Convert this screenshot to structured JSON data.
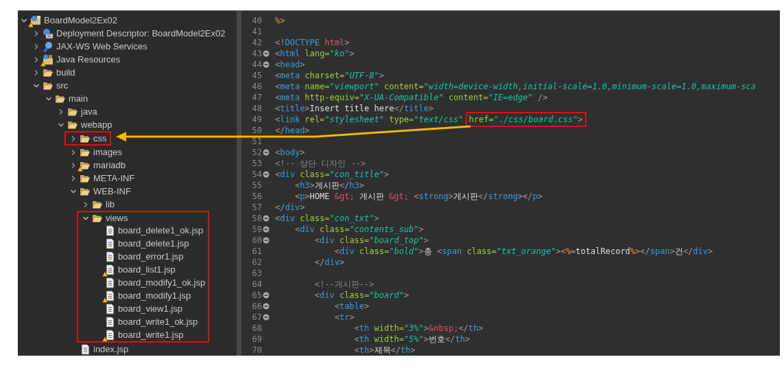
{
  "project_explorer": {
    "tree": [
      {
        "label": "BoardModel2Ex02",
        "kind": "project",
        "warning": true,
        "expanded": true,
        "highlighted": false,
        "children": [
          {
            "label": "Deployment Descriptor: BoardModel2Ex02",
            "kind": "descriptor",
            "warning": false,
            "expanded": false,
            "highlighted": false
          },
          {
            "label": "JAX-WS Web Services",
            "kind": "services",
            "warning": false,
            "expanded": false,
            "highlighted": false
          },
          {
            "label": "Java Resources",
            "kind": "resources",
            "warning": true,
            "expanded": false,
            "highlighted": false
          },
          {
            "label": "build",
            "kind": "folder",
            "warning": false,
            "expanded": false,
            "highlighted": false
          },
          {
            "label": "src",
            "kind": "folder",
            "warning": false,
            "expanded": true,
            "highlighted": false,
            "children": [
              {
                "label": "main",
                "kind": "folder",
                "warning": false,
                "expanded": true,
                "highlighted": false,
                "children": [
                  {
                    "label": "java",
                    "kind": "folder",
                    "warning": false,
                    "expanded": false,
                    "highlighted": false
                  },
                  {
                    "label": "webapp",
                    "kind": "folder",
                    "warning": false,
                    "expanded": true,
                    "highlighted": false,
                    "children": [
                      {
                        "label": "css",
                        "kind": "folder",
                        "warning": false,
                        "expanded": false,
                        "highlighted": true
                      },
                      {
                        "label": "images",
                        "kind": "folder",
                        "warning": false,
                        "expanded": false,
                        "highlighted": false
                      },
                      {
                        "label": "mariadb",
                        "kind": "folder",
                        "warning": true,
                        "expanded": false,
                        "highlighted": false
                      },
                      {
                        "label": "META-INF",
                        "kind": "folder",
                        "warning": false,
                        "expanded": false,
                        "highlighted": false
                      },
                      {
                        "label": "WEB-INF",
                        "kind": "folder",
                        "warning": false,
                        "expanded": true,
                        "highlighted": false,
                        "children": [
                          {
                            "label": "lib",
                            "kind": "folder",
                            "warning": false,
                            "expanded": false,
                            "highlighted": false
                          },
                          {
                            "label": "views",
                            "kind": "folder",
                            "warning": false,
                            "expanded": true,
                            "highlighted": true,
                            "children": [
                              {
                                "label": "board_delete1_ok.jsp",
                                "kind": "file",
                                "warning": false,
                                "highlighted": false
                              },
                              {
                                "label": "board_delete1.jsp",
                                "kind": "file",
                                "warning": false,
                                "highlighted": false
                              },
                              {
                                "label": "board_error1.jsp",
                                "kind": "file",
                                "warning": false,
                                "highlighted": false
                              },
                              {
                                "label": "board_list1.jsp",
                                "kind": "file",
                                "warning": true,
                                "highlighted": false
                              },
                              {
                                "label": "board_modify1_ok.jsp",
                                "kind": "file",
                                "warning": false,
                                "highlighted": false
                              },
                              {
                                "label": "board_modify1.jsp",
                                "kind": "file",
                                "warning": true,
                                "highlighted": false
                              },
                              {
                                "label": "board_view1.jsp",
                                "kind": "file",
                                "warning": false,
                                "highlighted": false
                              },
                              {
                                "label": "board_write1_ok.jsp",
                                "kind": "file",
                                "warning": false,
                                "highlighted": false
                              },
                              {
                                "label": "board_write1.jsp",
                                "kind": "file",
                                "warning": true,
                                "highlighted": false
                              }
                            ]
                          }
                        ]
                      },
                      {
                        "label": "index.jsp",
                        "kind": "file",
                        "warning": false,
                        "highlighted": false
                      }
                    ]
                  }
                ]
              }
            ]
          }
        ]
      }
    ]
  },
  "editor": {
    "lines": [
      {
        "number": "40",
        "fold": false,
        "tokens": [
          {
            "kind": "jsp",
            "text": "%>"
          }
        ]
      },
      {
        "number": "41",
        "fold": false
      },
      {
        "number": "42",
        "fold": false,
        "tokens": [
          {
            "kind": "punct",
            "text": "<!"
          },
          {
            "kind": "tag",
            "text": "DOCTYPE "
          },
          {
            "kind": "entity",
            "text": "html"
          },
          {
            "kind": "punct",
            "text": ">"
          }
        ]
      },
      {
        "number": "43",
        "fold": true,
        "tokens": [
          {
            "kind": "punct",
            "text": "<"
          },
          {
            "kind": "tag",
            "text": "html "
          },
          {
            "kind": "attr",
            "text": "lang="
          },
          {
            "kind": "value",
            "text": "\"ko\""
          },
          {
            "kind": "punct",
            "text": ">"
          }
        ]
      },
      {
        "number": "44",
        "fold": true,
        "tokens": [
          {
            "kind": "punct",
            "text": "<"
          },
          {
            "kind": "tag",
            "text": "head"
          },
          {
            "kind": "punct",
            "text": ">"
          }
        ]
      },
      {
        "number": "45",
        "fold": false,
        "tokens": [
          {
            "kind": "punct",
            "text": "<"
          },
          {
            "kind": "tag",
            "text": "meta "
          },
          {
            "kind": "attr",
            "text": "charset="
          },
          {
            "kind": "value",
            "text": "\"UTF-8\""
          },
          {
            "kind": "punct",
            "text": ">"
          }
        ]
      },
      {
        "number": "46",
        "fold": false,
        "tokens": [
          {
            "kind": "punct",
            "text": "<"
          },
          {
            "kind": "tag",
            "text": "meta "
          },
          {
            "kind": "attr",
            "text": "name="
          },
          {
            "kind": "value",
            "text": "\"viewport\" "
          },
          {
            "kind": "attr",
            "text": "content="
          },
          {
            "kind": "value",
            "text": "\"width=device-width,initial-scale=1.0,minimum-scale=1.0,maximum-sca"
          }
        ]
      },
      {
        "number": "47",
        "fold": false,
        "tokens": [
          {
            "kind": "punct",
            "text": "<"
          },
          {
            "kind": "tag",
            "text": "meta "
          },
          {
            "kind": "attr",
            "text": "http-equiv="
          },
          {
            "kind": "value",
            "text": "\"X-UA-Compatible\" "
          },
          {
            "kind": "attr",
            "text": "content="
          },
          {
            "kind": "value",
            "text": "\"IE=edge\" "
          },
          {
            "kind": "punct",
            "text": "/>"
          }
        ]
      },
      {
        "number": "48",
        "fold": false,
        "tokens": [
          {
            "kind": "punct",
            "text": "<"
          },
          {
            "kind": "tag",
            "text": "title"
          },
          {
            "kind": "punct",
            "text": ">"
          },
          {
            "kind": "text",
            "text": "Insert title here"
          },
          {
            "kind": "punct",
            "text": "</"
          },
          {
            "kind": "tag",
            "text": "title"
          },
          {
            "kind": "punct",
            "text": ">"
          }
        ]
      },
      {
        "number": "49",
        "fold": false,
        "tokens": [
          {
            "kind": "punct",
            "text": "<"
          },
          {
            "kind": "tag",
            "text": "link "
          },
          {
            "kind": "attr",
            "text": "rel="
          },
          {
            "kind": "value",
            "text": "\"stylesheet\" "
          },
          {
            "kind": "attr",
            "text": "type="
          },
          {
            "kind": "value",
            "text": "\"text/css\""
          }
        ],
        "boxed": [
          {
            "kind": "attr",
            "text": "href="
          },
          {
            "kind": "value",
            "text": "\"./css/board.css\""
          },
          {
            "kind": "punct",
            "text": ">"
          }
        ]
      },
      {
        "number": "50",
        "fold": false,
        "tokens": [
          {
            "kind": "punct",
            "text": "</"
          },
          {
            "kind": "tag",
            "text": "head"
          },
          {
            "kind": "punct",
            "text": ">"
          }
        ]
      },
      {
        "number": "51",
        "fold": false
      },
      {
        "number": "52",
        "fold": true,
        "tokens": [
          {
            "kind": "punct",
            "text": "<"
          },
          {
            "kind": "tag",
            "text": "body"
          },
          {
            "kind": "punct",
            "text": ">"
          }
        ]
      },
      {
        "number": "53",
        "fold": false,
        "tokens": [
          {
            "kind": "comment",
            "text": "<!-- 상단 디자인 -->"
          }
        ]
      },
      {
        "number": "54",
        "fold": true,
        "tokens": [
          {
            "kind": "punct",
            "text": "<"
          },
          {
            "kind": "tag",
            "text": "div "
          },
          {
            "kind": "attr",
            "text": "class="
          },
          {
            "kind": "value",
            "text": "\"con_title\""
          },
          {
            "kind": "punct",
            "text": ">"
          }
        ]
      },
      {
        "number": "55",
        "fold": false,
        "tokens": [
          {
            "kind": "punct",
            "text": "    <"
          },
          {
            "kind": "tag",
            "text": "h3"
          },
          {
            "kind": "punct",
            "text": ">"
          },
          {
            "kind": "text",
            "text": "게시판"
          },
          {
            "kind": "punct",
            "text": "</"
          },
          {
            "kind": "tag",
            "text": "h3"
          },
          {
            "kind": "punct",
            "text": ">"
          }
        ]
      },
      {
        "number": "56",
        "fold": false,
        "tokens": [
          {
            "kind": "punct",
            "text": "    <"
          },
          {
            "kind": "tag",
            "text": "p"
          },
          {
            "kind": "punct",
            "text": ">"
          },
          {
            "kind": "text",
            "text": "HOME "
          },
          {
            "kind": "entity",
            "text": "&gt;"
          },
          {
            "kind": "text",
            "text": " 게시판 "
          },
          {
            "kind": "entity",
            "text": "&gt;"
          },
          {
            "kind": "punct",
            "text": " <"
          },
          {
            "kind": "tag",
            "text": "strong"
          },
          {
            "kind": "punct",
            "text": ">"
          },
          {
            "kind": "text",
            "text": "게시판"
          },
          {
            "kind": "punct",
            "text": "</"
          },
          {
            "kind": "tag",
            "text": "strong"
          },
          {
            "kind": "punct",
            "text": "></"
          },
          {
            "kind": "tag",
            "text": "p"
          },
          {
            "kind": "punct",
            "text": ">"
          }
        ]
      },
      {
        "number": "57",
        "fold": false,
        "tokens": [
          {
            "kind": "punct",
            "text": "</"
          },
          {
            "kind": "tag",
            "text": "div"
          },
          {
            "kind": "punct",
            "text": ">"
          }
        ]
      },
      {
        "number": "58",
        "fold": true,
        "tokens": [
          {
            "kind": "punct",
            "text": "<"
          },
          {
            "kind": "tag",
            "text": "div "
          },
          {
            "kind": "attr",
            "text": "class="
          },
          {
            "kind": "value",
            "text": "\"con_txt\""
          },
          {
            "kind": "punct",
            "text": ">"
          }
        ]
      },
      {
        "number": "59",
        "fold": true,
        "tokens": [
          {
            "kind": "punct",
            "text": "    <"
          },
          {
            "kind": "tag",
            "text": "div "
          },
          {
            "kind": "attr",
            "text": "class="
          },
          {
            "kind": "value",
            "text": "\"contents_sub\""
          },
          {
            "kind": "punct",
            "text": ">"
          }
        ]
      },
      {
        "number": "60",
        "fold": true,
        "tokens": [
          {
            "kind": "punct",
            "text": "        <"
          },
          {
            "kind": "tag",
            "text": "div "
          },
          {
            "kind": "attr",
            "text": "class="
          },
          {
            "kind": "value",
            "text": "\"board_top\""
          },
          {
            "kind": "punct",
            "text": ">"
          }
        ]
      },
      {
        "number": "61",
        "fold": false,
        "tokens": [
          {
            "kind": "punct",
            "text": "            <"
          },
          {
            "kind": "tag",
            "text": "div "
          },
          {
            "kind": "attr",
            "text": "class="
          },
          {
            "kind": "value",
            "text": "\"bold\""
          },
          {
            "kind": "punct",
            "text": ">"
          },
          {
            "kind": "text",
            "text": "총 "
          },
          {
            "kind": "punct",
            "text": "<"
          },
          {
            "kind": "tag",
            "text": "span "
          },
          {
            "kind": "attr",
            "text": "class="
          },
          {
            "kind": "value",
            "text": "\"txt_orange\""
          },
          {
            "kind": "punct",
            "text": ">"
          },
          {
            "kind": "jsp",
            "text": "<%="
          },
          {
            "kind": "text",
            "text": "totalRecord"
          },
          {
            "kind": "jsp",
            "text": "%>"
          },
          {
            "kind": "punct",
            "text": "</"
          },
          {
            "kind": "tag",
            "text": "span"
          },
          {
            "kind": "punct",
            "text": ">"
          },
          {
            "kind": "text",
            "text": "건"
          },
          {
            "kind": "punct",
            "text": "</"
          },
          {
            "kind": "tag",
            "text": "div"
          },
          {
            "kind": "punct",
            "text": ">"
          }
        ]
      },
      {
        "number": "62",
        "fold": false,
        "tokens": [
          {
            "kind": "punct",
            "text": "        </"
          },
          {
            "kind": "tag",
            "text": "div"
          },
          {
            "kind": "punct",
            "text": ">"
          }
        ]
      },
      {
        "number": "63",
        "fold": false
      },
      {
        "number": "64",
        "fold": false,
        "tokens": [
          {
            "kind": "comment",
            "text": "        <!--게시판-->"
          }
        ]
      },
      {
        "number": "65",
        "fold": true,
        "tokens": [
          {
            "kind": "punct",
            "text": "        <"
          },
          {
            "kind": "tag",
            "text": "div "
          },
          {
            "kind": "attr",
            "text": "class="
          },
          {
            "kind": "value",
            "text": "\"board\""
          },
          {
            "kind": "punct",
            "text": ">"
          }
        ]
      },
      {
        "number": "66",
        "fold": true,
        "tokens": [
          {
            "kind": "punct",
            "text": "            <"
          },
          {
            "kind": "tag",
            "text": "table"
          },
          {
            "kind": "punct",
            "text": ">"
          }
        ]
      },
      {
        "number": "67",
        "fold": true,
        "tokens": [
          {
            "kind": "punct",
            "text": "            <"
          },
          {
            "kind": "tag",
            "text": "tr"
          },
          {
            "kind": "punct",
            "text": ">"
          }
        ]
      },
      {
        "number": "68",
        "fold": false,
        "tokens": [
          {
            "kind": "punct",
            "text": "                <"
          },
          {
            "kind": "tag",
            "text": "th "
          },
          {
            "kind": "attr",
            "text": "width="
          },
          {
            "kind": "value",
            "text": "\"3%\""
          },
          {
            "kind": "punct",
            "text": ">"
          },
          {
            "kind": "entity",
            "text": "&nbsp;"
          },
          {
            "kind": "punct",
            "text": "</"
          },
          {
            "kind": "tag",
            "text": "th"
          },
          {
            "kind": "punct",
            "text": ">"
          }
        ]
      },
      {
        "number": "69",
        "fold": false,
        "tokens": [
          {
            "kind": "punct",
            "text": "                <"
          },
          {
            "kind": "tag",
            "text": "th "
          },
          {
            "kind": "attr",
            "text": "width="
          },
          {
            "kind": "value",
            "text": "\"5%\""
          },
          {
            "kind": "punct",
            "text": ">"
          },
          {
            "kind": "text",
            "text": "번호"
          },
          {
            "kind": "punct",
            "text": "</"
          },
          {
            "kind": "tag",
            "text": "th"
          },
          {
            "kind": "punct",
            "text": ">"
          }
        ]
      },
      {
        "number": "70",
        "fold": false,
        "tokens": [
          {
            "kind": "punct",
            "text": "                <"
          },
          {
            "kind": "tag",
            "text": "th"
          },
          {
            "kind": "punct",
            "text": ">"
          },
          {
            "kind": "text",
            "text": "제목"
          },
          {
            "kind": "punct",
            "text": "</"
          },
          {
            "kind": "tag",
            "text": "th"
          },
          {
            "kind": "punct",
            "text": ">"
          }
        ]
      }
    ]
  }
}
